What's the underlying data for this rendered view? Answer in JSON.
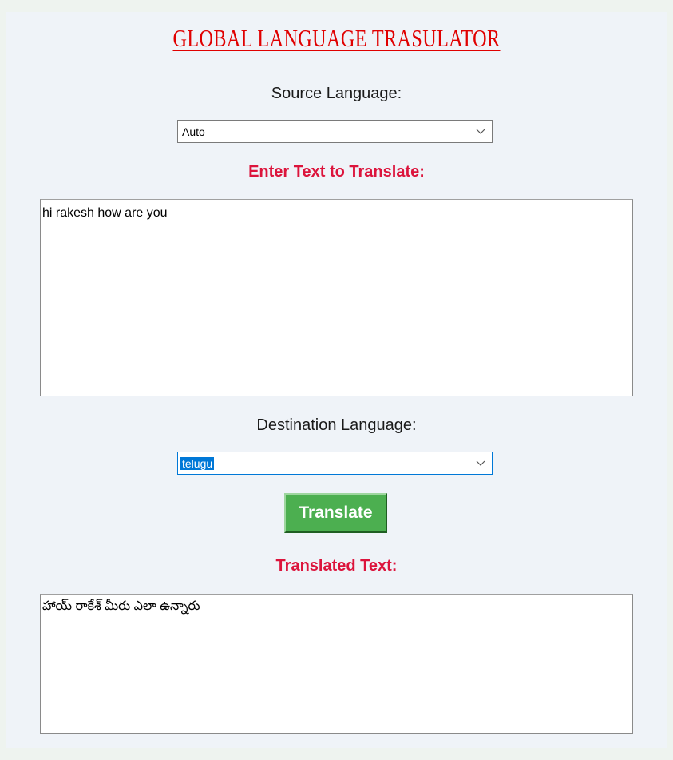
{
  "app": {
    "title": "GLOBAL LANGUAGE TRASULATOR"
  },
  "source": {
    "label": "Source Language:",
    "selected": "Auto"
  },
  "input": {
    "heading": "Enter Text to Translate:",
    "value": "hi rakesh how are you"
  },
  "destination": {
    "label": "Destination Language:",
    "selected": "telugu"
  },
  "actions": {
    "translate_label": "Translate"
  },
  "output": {
    "heading": "Translated Text:",
    "value": "హాయ్ రాకేశ్ మీరు ఎలా ఉన్నారు"
  },
  "colors": {
    "title": "#e00000",
    "heading": "#dc143c",
    "button": "#4caf50",
    "focus": "#0078d7"
  },
  "icons": {
    "dropdown": "chevron-down-icon"
  }
}
